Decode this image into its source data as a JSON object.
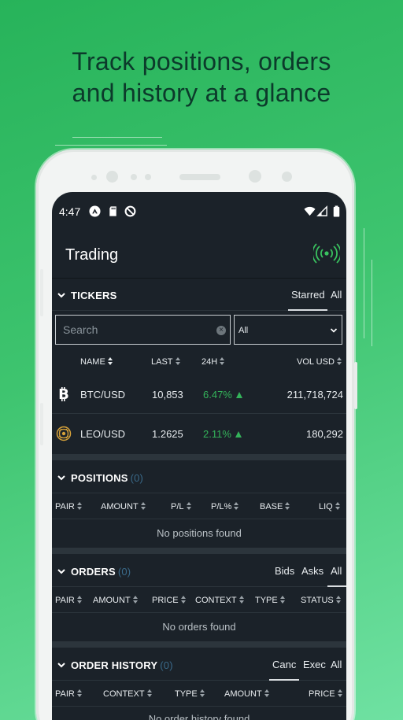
{
  "headline": {
    "line1": "Track positions, orders",
    "line2": "and history at a glance"
  },
  "status_bar": {
    "time": "4:47"
  },
  "app_bar": {
    "title": "Trading"
  },
  "tickers": {
    "title": "TICKERS",
    "tabs": [
      "Starred",
      "All"
    ],
    "active_tab": "Starred",
    "search": {
      "placeholder": "Search",
      "value": ""
    },
    "filter": {
      "selected": "All"
    },
    "columns": [
      "NAME",
      "LAST",
      "24H",
      "VOL USD"
    ],
    "rows": [
      {
        "icon": "bitcoin-icon",
        "name": "BTC/USD",
        "last": "10,853",
        "change": "6.47%",
        "volume": "211,718,724"
      },
      {
        "icon": "leo-icon",
        "name": "LEO/USD",
        "last": "1.2625",
        "change": "2.11%",
        "volume": "180,292"
      }
    ]
  },
  "positions": {
    "title": "POSITIONS",
    "count": "(0)",
    "columns": [
      "PAIR",
      "AMOUNT",
      "P/L",
      "P/L%",
      "BASE",
      "LIQ"
    ],
    "empty": "No positions found"
  },
  "orders": {
    "title": "ORDERS",
    "count": "(0)",
    "tabs": [
      "Bids",
      "Asks",
      "All"
    ],
    "active_tab": "All",
    "columns": [
      "PAIR",
      "AMOUNT",
      "PRICE",
      "CONTEXT",
      "TYPE",
      "STATUS"
    ],
    "empty": "No orders found"
  },
  "order_history": {
    "title": "ORDER HISTORY",
    "count": "(0)",
    "tabs": [
      "Canc",
      "Exec",
      "All"
    ],
    "active_tab": "Canc",
    "columns": [
      "PAIR",
      "CONTEXT",
      "TYPE",
      "AMOUNT",
      "PRICE"
    ],
    "empty": "No order history found"
  },
  "colors": {
    "background_gradient": [
      "#27b35a",
      "#6fe1a2"
    ],
    "screen": "#1b2229",
    "positive": "#34b35a",
    "live_icon": "#39c25f",
    "leo_icon": "#d8a33a"
  }
}
